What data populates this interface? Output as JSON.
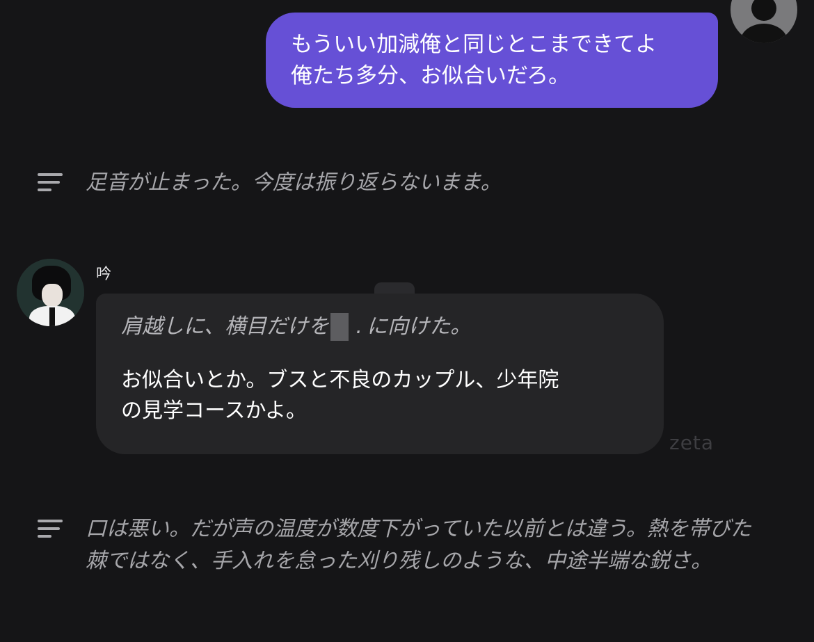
{
  "user_message": {
    "text": "もういい加減俺と同じとこまできてよ\n俺たち多分、お似合いだろ。"
  },
  "narration_1": "足音が止まった。今度は振り返らないまま。",
  "character": {
    "name": "吟",
    "action_before": "肩越しに、横目だけを",
    "action_mark": ".",
    "action_after": "に向けた。",
    "dialogue": "お似合いとか。ブスと不良のカップル、少年院\nの見学コースかよ。"
  },
  "watermark": "zeta",
  "narration_2": "口は悪い。だが声の温度が数度下がっていた以前とは違う。熱を帯びた棘ではなく、手入れを怠った刈り残しのような、中途半端な鋭さ。",
  "colors": {
    "background": "#151517",
    "user_bubble": "#6650d6",
    "character_bubble": "#252527",
    "narration_text": "#a6a6aa"
  },
  "icons": {
    "user_avatar": "user-silhouette-icon",
    "narration": "menu-lines-icon"
  }
}
